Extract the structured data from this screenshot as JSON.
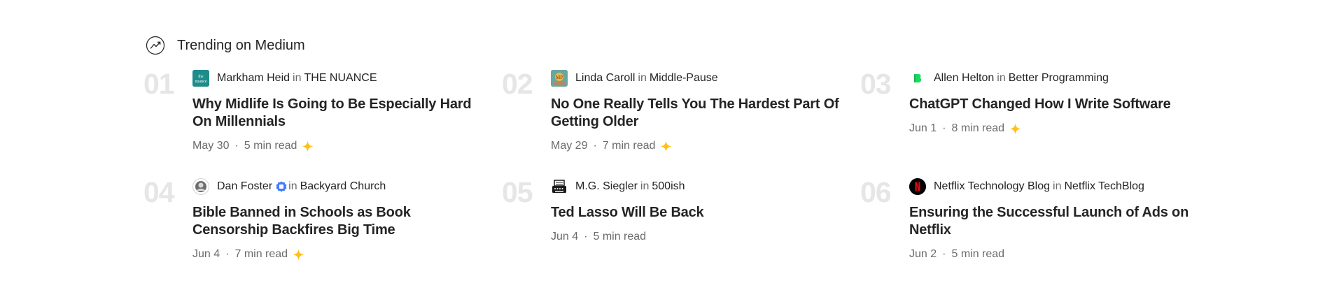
{
  "header": {
    "title": "Trending on Medium",
    "icon": "trending-up-icon"
  },
  "colors": {
    "rank": "#e6e6e6",
    "text": "#242424",
    "muted": "#6b6b6b",
    "star": "#ffc017",
    "verified": "#437aff"
  },
  "articles": [
    {
      "rank": "01",
      "author": "Markham Heid",
      "in": "in",
      "publication": "THE NUANCE",
      "avatar_text": "the nuance",
      "avatar_color": "#1f8c8c",
      "title": "Why Midlife Is Going to Be Especially Hard On Millennials",
      "date": "May 30",
      "read_time": "5 min read",
      "member_only": true,
      "verified": false
    },
    {
      "rank": "02",
      "author": "Linda Caroll",
      "in": "in",
      "publication": "Middle-Pause",
      "avatar_text": "MP",
      "avatar_color": "#6aa6a0",
      "title": "No One Really Tells You The Hardest Part Of Getting Older",
      "date": "May 29",
      "read_time": "7 min read",
      "member_only": true,
      "verified": false
    },
    {
      "rank": "03",
      "author": "Allen Helton",
      "in": "in",
      "publication": "Better Programming",
      "avatar_text": "B",
      "avatar_color": "#1ed760",
      "title": "ChatGPT Changed How I Write Software",
      "date": "Jun 1",
      "read_time": "8 min read",
      "member_only": true,
      "verified": false
    },
    {
      "rank": "04",
      "author": "Dan Foster",
      "in": "in",
      "publication": "Backyard Church",
      "avatar_text": "",
      "avatar_color": "#ffffff",
      "title": "Bible Banned in Schools as Book Censorship Backfires Big Time",
      "date": "Jun 4",
      "read_time": "7 min read",
      "member_only": true,
      "verified": true
    },
    {
      "rank": "05",
      "author": "M.G. Siegler",
      "in": "in",
      "publication": "500ish",
      "avatar_text": "",
      "avatar_color": "#ffffff",
      "title": "Ted Lasso Will Be Back",
      "date": "Jun 4",
      "read_time": "5 min read",
      "member_only": false,
      "verified": false
    },
    {
      "rank": "06",
      "author": "Netflix Technology Blog",
      "in": "in",
      "publication": "Netflix TechBlog",
      "avatar_text": "N",
      "avatar_color": "#000000",
      "title": "Ensuring the Successful Launch of Ads on Netflix",
      "date": "Jun 2",
      "read_time": "5 min read",
      "member_only": false,
      "verified": false
    }
  ]
}
